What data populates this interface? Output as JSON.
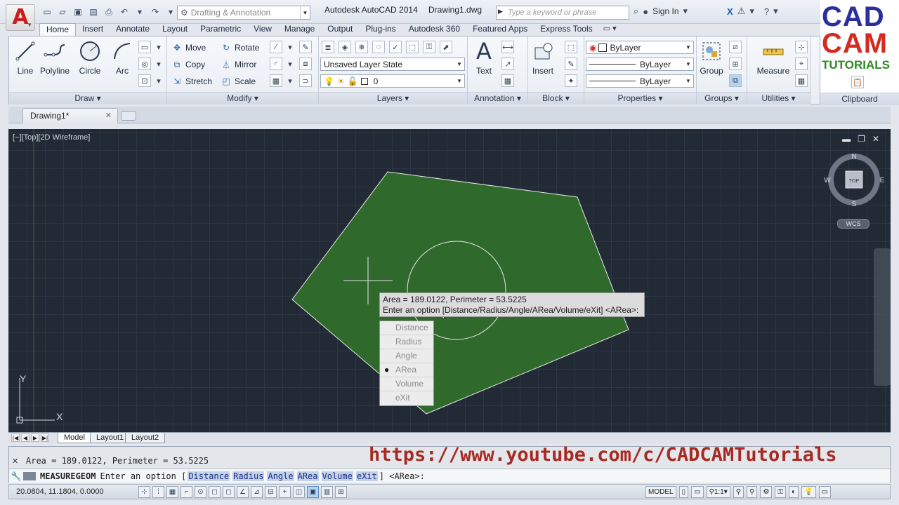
{
  "app": {
    "title": "Autodesk AutoCAD 2014",
    "document": "Drawing1.dwg",
    "workspace": "Drafting & Annotation",
    "search_placeholder": "Type a keyword or phrase",
    "sign_in": "Sign In",
    "app_button_glyph": "A"
  },
  "ribbon_tabs": [
    "Home",
    "Insert",
    "Annotate",
    "Layout",
    "Parametric",
    "View",
    "Manage",
    "Output",
    "Plug-ins",
    "Autodesk 360",
    "Featured Apps",
    "Express Tools"
  ],
  "panels": {
    "draw": {
      "title": "Draw",
      "tools": [
        "Line",
        "Polyline",
        "Circle",
        "Arc"
      ]
    },
    "modify": {
      "title": "Modify",
      "tools": [
        "Move",
        "Rotate",
        "Copy",
        "Mirror",
        "Stretch",
        "Scale"
      ]
    },
    "layers": {
      "title": "Layers",
      "layer_state": "Unsaved Layer State",
      "current_layer": "0"
    },
    "annotation": {
      "title": "Annotation",
      "text": "Text"
    },
    "block": {
      "title": "Block",
      "insert": "Insert"
    },
    "properties": {
      "title": "Properties",
      "color": "ByLayer",
      "linetype": "ByLayer",
      "lineweight": "ByLayer"
    },
    "groups": {
      "title": "Groups",
      "group": "Group"
    },
    "utilities": {
      "title": "Utilities",
      "measure": "Measure"
    },
    "clipboard": {
      "title": "Clipboard"
    }
  },
  "logo": {
    "line1": "CAD",
    "line2": "CAM",
    "line3": "TUTORIALS"
  },
  "doc_tab": "Drawing1*",
  "viewport": {
    "label": "[−][Top][2D Wireframe]",
    "viewcube": {
      "n": "N",
      "s": "S",
      "e": "E",
      "w": "W",
      "face": "TOP"
    },
    "wcs": "WCS",
    "ucs_x": "X",
    "ucs_y": "Y"
  },
  "tooltip": {
    "line1": "Area = 189.0122, Perimeter = 53.5225",
    "line2": "Enter an option [Distance/Radius/Angle/ARea/Volume/eXit] <ARea>:"
  },
  "dynamic_menu": [
    "Distance",
    "Radius",
    "Angle",
    "ARea",
    "Volume",
    "eXit"
  ],
  "dynamic_menu_selected": "ARea",
  "layout_tabs": [
    "Model",
    "Layout1",
    "Layout2"
  ],
  "command": {
    "history": "Area = 189.0122, Perimeter = 53.5225",
    "name": "MEASUREGEOM",
    "prompt": "Enter an option [",
    "options": [
      "Distance",
      "Radius",
      "Angle",
      "ARea",
      "Volume",
      "eXit"
    ],
    "suffix": "] <ARea>:"
  },
  "watermark_url": "https://www.youtube.com/c/CADCAMTutorials",
  "status": {
    "coords": "20.0804, 11.1804, 0.0000",
    "model": "MODEL",
    "scale": "1:1"
  },
  "colors": {
    "fill": "#2f6a2c",
    "background": "#222a36",
    "accent": "#c8201f"
  }
}
